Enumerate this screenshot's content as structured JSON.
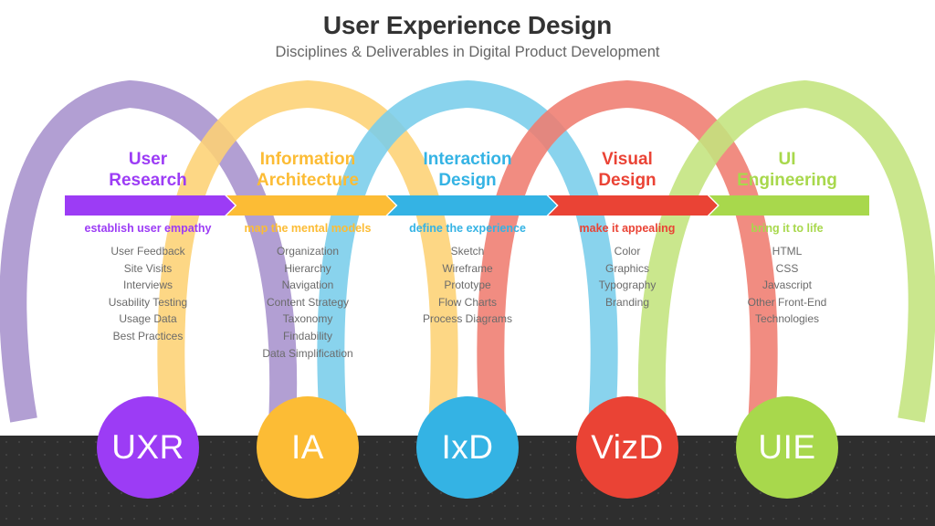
{
  "header": {
    "title": "User Experience Design",
    "subtitle": "Disciplines & Deliverables in Digital Product Development",
    "title_color": "#333333",
    "subtitle_color": "#666666"
  },
  "theme": {
    "background": "#ffffff",
    "footer_band": "#2e2e2e"
  },
  "columns": [
    {
      "key": "user-research",
      "heading": "User\nResearch",
      "tagline": "establish user empathy",
      "badge": "UXR",
      "color": "#9c3cf5",
      "arc_color": "#a792cd",
      "items": [
        "User Feedback",
        "Site Visits",
        "Interviews",
        "Usability Testing",
        "Usage Data",
        "Best Practices"
      ]
    },
    {
      "key": "information-architecture",
      "heading": "Information\nArchitecture",
      "tagline": "map the mental models",
      "badge": "IA",
      "color": "#fcbc35",
      "arc_color": "#fdd274",
      "items": [
        "Organization",
        "Hierarchy",
        "Navigation",
        "Content Strategy",
        "Taxonomy",
        "Findability",
        "Data Simplification"
      ]
    },
    {
      "key": "interaction-design",
      "heading": "Interaction\nDesign",
      "tagline": "define the experience",
      "badge": "IxD",
      "color": "#34b3e4",
      "arc_color": "#79cdeb",
      "items": [
        "Sketch",
        "Wireframe",
        "Prototype",
        "Flow Charts",
        "Process Diagrams"
      ]
    },
    {
      "key": "visual-design",
      "heading": "Visual\nDesign",
      "tagline": "make it appealing",
      "badge": "VizD",
      "color": "#ea4335",
      "arc_color": "#ef7c6f",
      "items": [
        "Color",
        "Graphics",
        "Typography",
        "Branding"
      ]
    },
    {
      "key": "ui-engineering",
      "heading": "UI\nEngineering",
      "tagline": "bring it to life",
      "badge": "UIE",
      "color": "#a8d84c",
      "arc_color": "#c3e47d",
      "items": [
        "HTML",
        "CSS",
        "Javascript",
        "Other Front-End\nTechnologies"
      ]
    }
  ]
}
